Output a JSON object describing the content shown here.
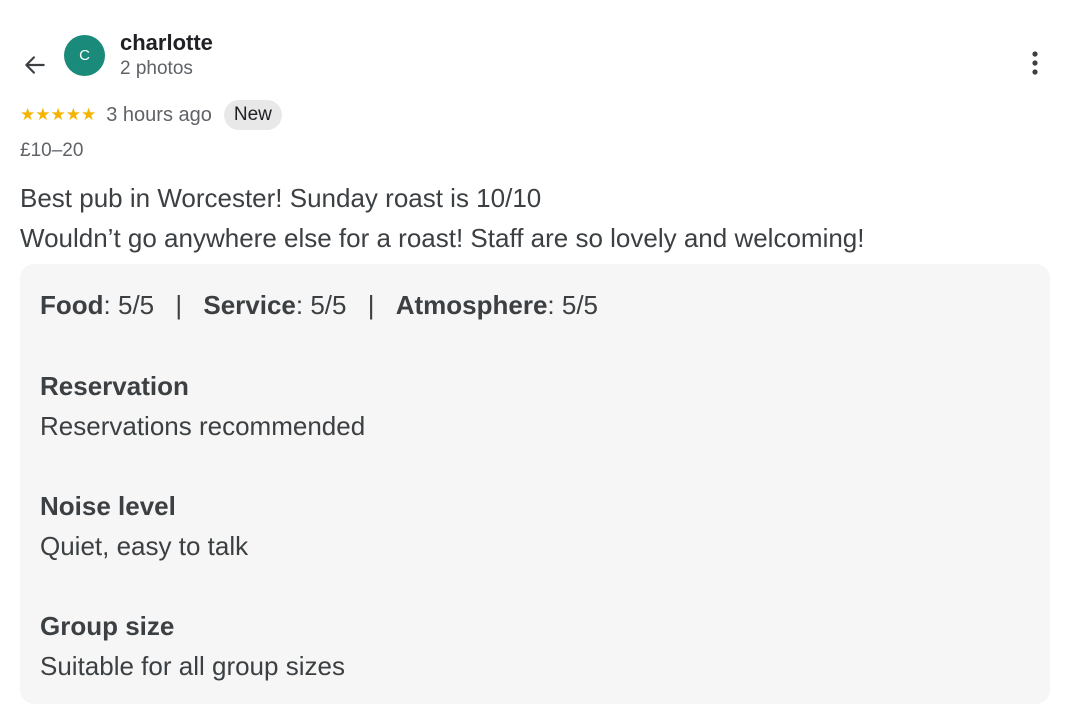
{
  "author": {
    "initial": "C",
    "name": "charlotte",
    "subtitle": "2 photos"
  },
  "review": {
    "stars": 5,
    "star_glyph": "★",
    "time": "3 hours ago",
    "badge": "New",
    "price": "£10–20",
    "text_line1": "Best pub in Worcester! Sunday roast is 10/10",
    "text_line2": "Wouldn’t go anywhere else for a roast! Staff are so lovely and welcoming!"
  },
  "ratings": {
    "food_label": "Food",
    "food_value": ": 5/5",
    "service_label": "Service",
    "service_value": ": 5/5",
    "atmosphere_label": "Atmosphere",
    "atmosphere_value": ": 5/5",
    "separator": "|"
  },
  "details": [
    {
      "label": "Reservation",
      "value": "Reservations recommended"
    },
    {
      "label": "Noise level",
      "value": "Quiet, easy to talk"
    },
    {
      "label": "Group size",
      "value": "Suitable for all group sizes"
    }
  ],
  "colors": {
    "avatar": "#1a8a7a",
    "star": "#f4b400",
    "badge_bg": "#e8e8e8",
    "details_bg": "#f6f6f6"
  },
  "icons": {
    "back": "arrow-left-icon",
    "more": "more-vertical-icon"
  }
}
